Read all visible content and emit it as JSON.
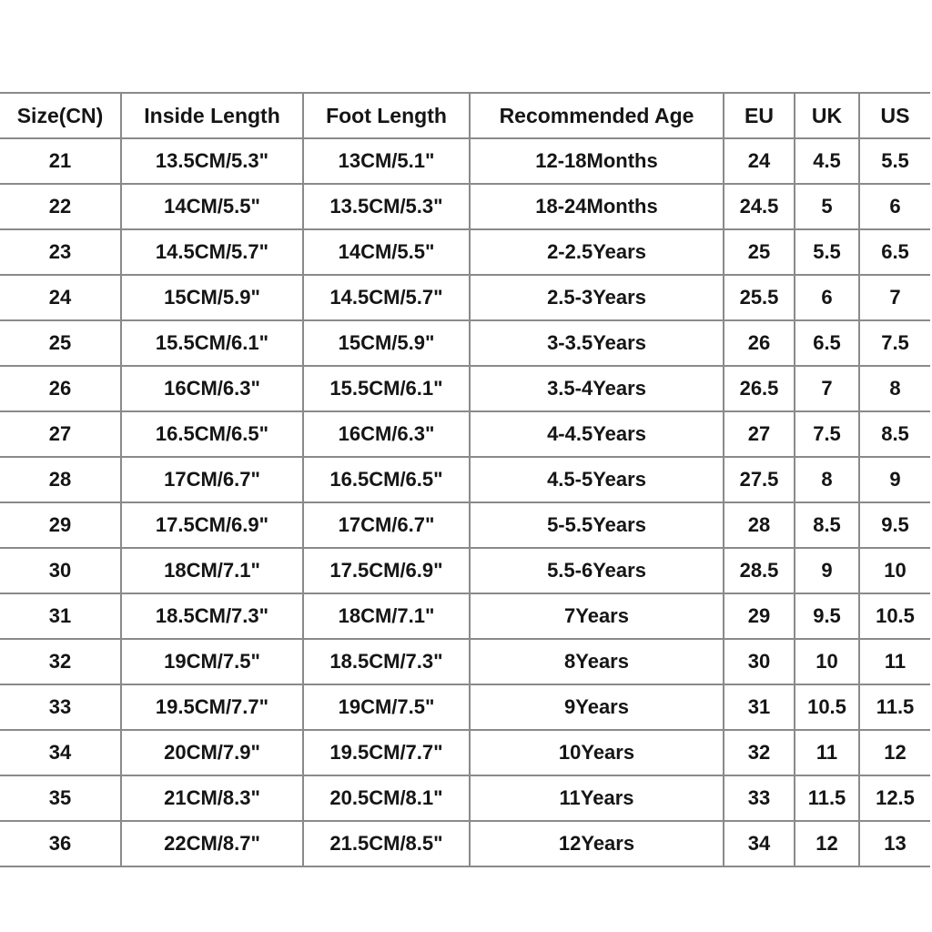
{
  "table": {
    "headers": [
      "Size(CN)",
      "Inside Length",
      "Foot Length",
      "Recommended Age",
      "EU",
      "UK",
      "US"
    ],
    "rows": [
      [
        "21",
        "13.5CM/5.3\"",
        "13CM/5.1\"",
        "12-18Months",
        "24",
        "4.5",
        "5.5"
      ],
      [
        "22",
        "14CM/5.5\"",
        "13.5CM/5.3\"",
        "18-24Months",
        "24.5",
        "5",
        "6"
      ],
      [
        "23",
        "14.5CM/5.7\"",
        "14CM/5.5\"",
        "2-2.5Years",
        "25",
        "5.5",
        "6.5"
      ],
      [
        "24",
        "15CM/5.9\"",
        "14.5CM/5.7\"",
        "2.5-3Years",
        "25.5",
        "6",
        "7"
      ],
      [
        "25",
        "15.5CM/6.1\"",
        "15CM/5.9\"",
        "3-3.5Years",
        "26",
        "6.5",
        "7.5"
      ],
      [
        "26",
        "16CM/6.3\"",
        "15.5CM/6.1\"",
        "3.5-4Years",
        "26.5",
        "7",
        "8"
      ],
      [
        "27",
        "16.5CM/6.5\"",
        "16CM/6.3\"",
        "4-4.5Years",
        "27",
        "7.5",
        "8.5"
      ],
      [
        "28",
        "17CM/6.7\"",
        "16.5CM/6.5\"",
        "4.5-5Years",
        "27.5",
        "8",
        "9"
      ],
      [
        "29",
        "17.5CM/6.9\"",
        "17CM/6.7\"",
        "5-5.5Years",
        "28",
        "8.5",
        "9.5"
      ],
      [
        "30",
        "18CM/7.1\"",
        "17.5CM/6.9\"",
        "5.5-6Years",
        "28.5",
        "9",
        "10"
      ],
      [
        "31",
        "18.5CM/7.3\"",
        "18CM/7.1\"",
        "7Years",
        "29",
        "9.5",
        "10.5"
      ],
      [
        "32",
        "19CM/7.5\"",
        "18.5CM/7.3\"",
        "8Years",
        "30",
        "10",
        "11"
      ],
      [
        "33",
        "19.5CM/7.7\"",
        "19CM/7.5\"",
        "9Years",
        "31",
        "10.5",
        "11.5"
      ],
      [
        "34",
        "20CM/7.9\"",
        "19.5CM/7.7\"",
        "10Years",
        "32",
        "11",
        "12"
      ],
      [
        "35",
        "21CM/8.3\"",
        "20.5CM/8.1\"",
        "11Years",
        "33",
        "11.5",
        "12.5"
      ],
      [
        "36",
        "22CM/8.7\"",
        "21.5CM/8.5\"",
        "12Years",
        "34",
        "12",
        "13"
      ]
    ]
  },
  "colors": {
    "background": "#ffffff",
    "text": "#151515",
    "gridline": "#8a8a8a"
  }
}
